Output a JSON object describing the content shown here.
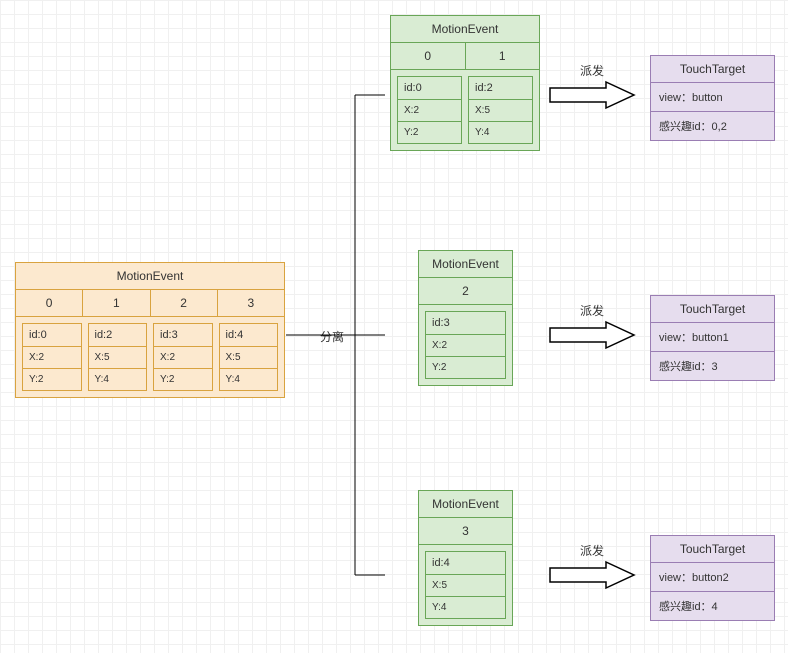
{
  "source": {
    "title": "MotionEvent",
    "indices": [
      "0",
      "1",
      "2",
      "3"
    ],
    "pointers": [
      {
        "id": "id:0",
        "x": "X:2",
        "y": "Y:2"
      },
      {
        "id": "id:2",
        "x": "X:5",
        "y": "Y:4"
      },
      {
        "id": "id:3",
        "x": "X:2",
        "y": "Y:2"
      },
      {
        "id": "id:4",
        "x": "X:5",
        "y": "Y:4"
      }
    ]
  },
  "splitLabel": "分离",
  "dispatchLabel": "派发",
  "splits": [
    {
      "title": "MotionEvent",
      "indices": [
        "0",
        "1"
      ],
      "pointers": [
        {
          "id": "id:0",
          "x": "X:2",
          "y": "Y:2"
        },
        {
          "id": "id:2",
          "x": "X:5",
          "y": "Y:4"
        }
      ]
    },
    {
      "title": "MotionEvent",
      "indices": [
        "2"
      ],
      "pointers": [
        {
          "id": "id:3",
          "x": "X:2",
          "y": "Y:2"
        }
      ]
    },
    {
      "title": "MotionEvent",
      "indices": [
        "3"
      ],
      "pointers": [
        {
          "id": "id:4",
          "x": "X:5",
          "y": "Y:4"
        }
      ]
    }
  ],
  "targets": [
    {
      "title": "TouchTarget",
      "view": "view：button",
      "ids": "感兴趣id：0,2"
    },
    {
      "title": "TouchTarget",
      "view": "view：button1",
      "ids": "感兴趣id：3"
    },
    {
      "title": "TouchTarget",
      "view": "view：button2",
      "ids": "感兴趣id：4"
    }
  ]
}
